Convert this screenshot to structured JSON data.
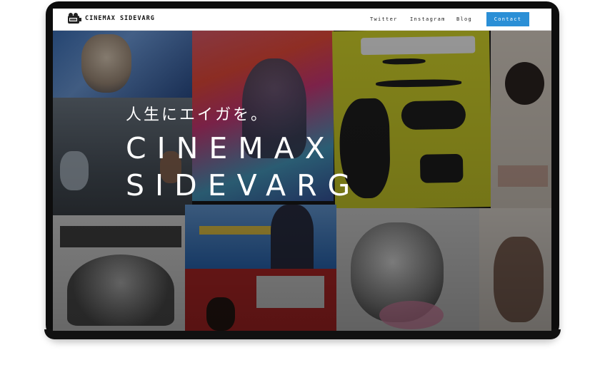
{
  "navbar": {
    "brand": "CINEMAX SIDEVARG",
    "links": [
      "Twitter",
      "Instagram",
      "Blog"
    ],
    "contact_label": "Contact"
  },
  "hero": {
    "tagline": "人生にエイガを。",
    "title_line1": "CINEMAX",
    "title_line2": "SIDEVARG"
  },
  "colors": {
    "contact_button": "#2b8fd6",
    "navbar_background": "#ffffff",
    "hero_text": "#ffffff"
  }
}
